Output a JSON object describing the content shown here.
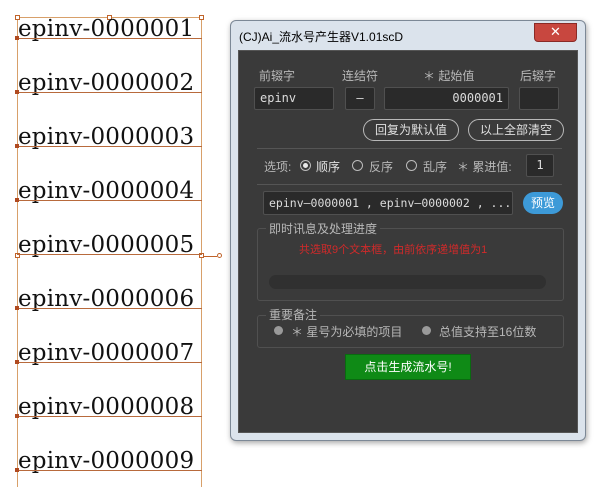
{
  "artboard": {
    "lines": [
      "epinv-0000001",
      "epinv-0000002",
      "epinv-0000003",
      "epinv-0000004",
      "epinv-0000005",
      "epinv-0000006",
      "epinv-0000007",
      "epinv-0000008",
      "epinv-0000009"
    ]
  },
  "window": {
    "title": "(CJ)Ai_流水号产生器V1.01scD",
    "close_glyph": "✕"
  },
  "fields": {
    "prefix_label": "前辍字",
    "connector_label": "连结符",
    "start_label": "＊ 起始值",
    "suffix_label": "后辍字",
    "prefix_value": "epinv",
    "connector_value": "–",
    "start_value": "0000001",
    "suffix_value": ""
  },
  "buttons": {
    "reset_defaults": "回复为默认值",
    "clear_all": "以上全部清空",
    "preview": "预览",
    "generate": "点击生成流水号!"
  },
  "options": {
    "label": "选项:",
    "sequential": "顺序",
    "reverse": "反序",
    "random": "乱序",
    "selected": "sequential",
    "step_label": "＊ 累进值:",
    "step_value": "1"
  },
  "preview_text": "epinv–0000001 , epinv–0000002 , ...",
  "progress_group": {
    "title": "即时讯息及处理进度",
    "message": "共选取9个文本框，由前依序递增值为1",
    "progress": 0
  },
  "notes": {
    "title": "重要备注",
    "note1": "＊ 星号为必填的项目",
    "note2": "总值支持至16位数"
  },
  "colors": {
    "dialog_bg": "#3a3a3a",
    "accent_blue": "#3d9ad8",
    "generate_green": "#0f8a16",
    "message_red": "#d02a2a"
  }
}
